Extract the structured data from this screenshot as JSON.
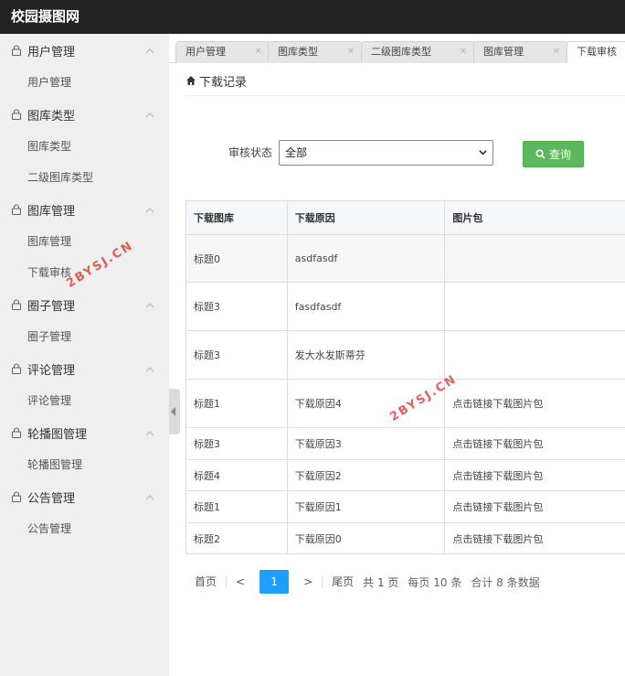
{
  "app_title": "校园摄图网",
  "sidebar": {
    "groups": [
      {
        "label": "用户管理",
        "items": [
          "用户管理"
        ]
      },
      {
        "label": "图库类型",
        "items": [
          "图库类型",
          "二级图库类型"
        ]
      },
      {
        "label": "图库管理",
        "items": [
          "图库管理",
          "下载审核"
        ]
      },
      {
        "label": "圈子管理",
        "items": [
          "圈子管理"
        ]
      },
      {
        "label": "评论管理",
        "items": [
          "评论管理"
        ]
      },
      {
        "label": "轮播图管理",
        "items": [
          "轮播图管理"
        ]
      },
      {
        "label": "公告管理",
        "items": [
          "公告管理"
        ]
      }
    ]
  },
  "tabs": [
    {
      "label": "用户管理"
    },
    {
      "label": "图库类型"
    },
    {
      "label": "二级图库类型"
    },
    {
      "label": "图库管理"
    },
    {
      "label": "下载审核"
    }
  ],
  "breadcrumb": "下载记录",
  "filter": {
    "label": "审核状态",
    "value": "全部"
  },
  "query_button": "查询",
  "table": {
    "headers": [
      "下载图库",
      "下载原因",
      "图片包"
    ],
    "rows": [
      [
        "标题0",
        "asdfasdf",
        ""
      ],
      [
        "标题3",
        "fasdfasdf",
        ""
      ],
      [
        "标题3",
        "发大水发斯蒂芬",
        ""
      ],
      [
        "标题1",
        "下载原因4",
        "点击链接下载图片包"
      ],
      [
        "标题3",
        "下载原因3",
        "点击链接下载图片包"
      ],
      [
        "标题4",
        "下载原因2",
        "点击链接下载图片包"
      ],
      [
        "标题1",
        "下载原因1",
        "点击链接下载图片包"
      ],
      [
        "标题2",
        "下载原因0",
        "点击链接下载图片包"
      ]
    ]
  },
  "pagination": {
    "first": "首页",
    "prev": "<",
    "current": "1",
    "next": ">",
    "last": "尾页",
    "total_pages": "共 1 页",
    "per_page": "每页 10 条",
    "total": "合计 8 条数据"
  },
  "watermark": "2BYSJ.CN",
  "colors": {
    "topbar": "#222222",
    "primary": "#1e9fff",
    "success": "#5cb85c"
  }
}
